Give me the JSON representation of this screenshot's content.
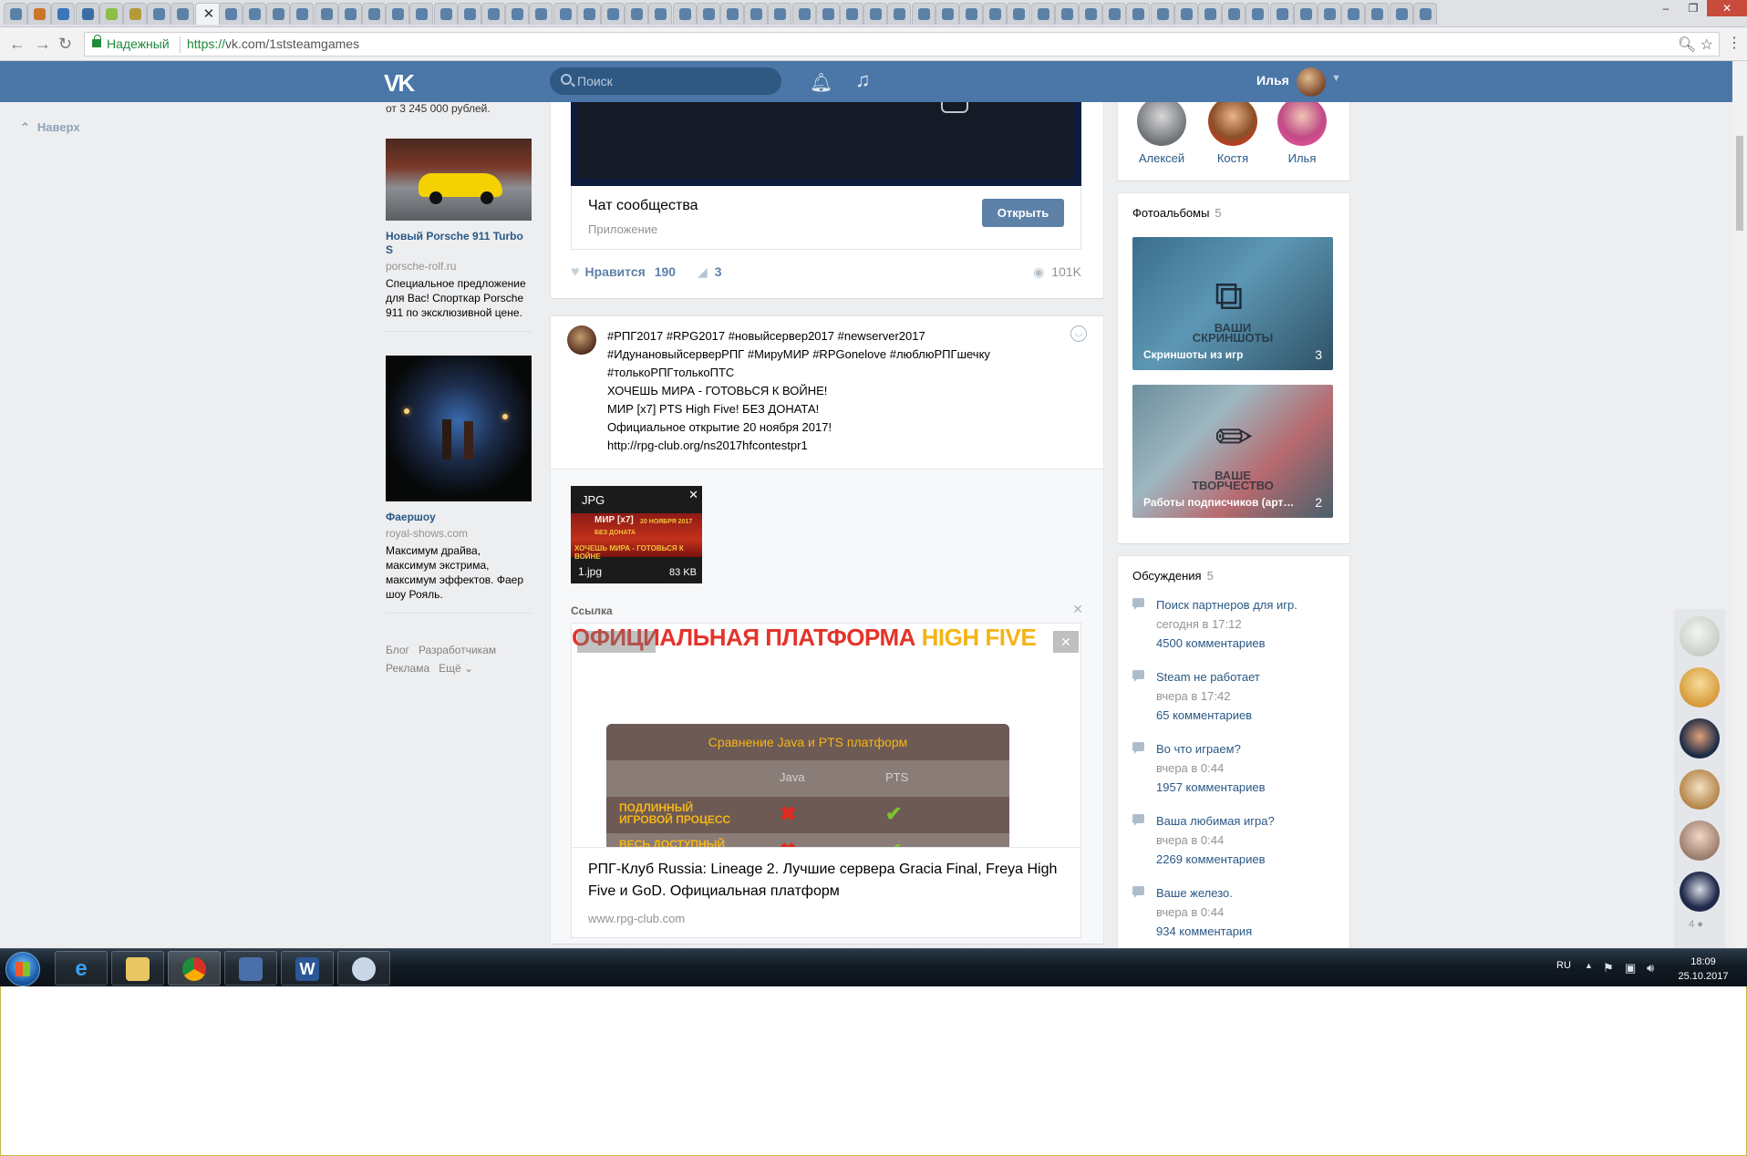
{
  "browser": {
    "secure_label": "Надежный",
    "url_scheme": "https://",
    "url_rest": "vk.com/1ststeamgames"
  },
  "vk_header": {
    "logo": "VK",
    "search_placeholder": "Поиск",
    "user_name": "Илья"
  },
  "left_nav": {
    "to_top": "Наверх"
  },
  "ads": {
    "prev_tail": "от 3 245 000 рублей.",
    "items": [
      {
        "title": "Новый Porsche 911 Turbo S",
        "domain": "porsche-rolf.ru",
        "text": "Специальное предложение для Вас! Спорткар Porsche 911 по эксклюзивной цене."
      },
      {
        "title": "Фаершоу",
        "domain": "royal-shows.com",
        "text": "Максимум драйва, максимум экстрима, максимум эффектов. Фаер шоу Рояль."
      }
    ],
    "footer": [
      "Блог",
      "Разработчикам",
      "Реклама",
      "Ещё ⌄"
    ]
  },
  "post1": {
    "app_title": "Чат сообщества",
    "app_subtitle": "Приложение",
    "open_button": "Открыть",
    "like_label": "Нравится",
    "like_count": "190",
    "share_count": "3",
    "views": "101K"
  },
  "post2": {
    "lines": [
      "#РПГ2017 #RPG2017 #новыйсервер2017 #newserver2017",
      "#ИдунановыйсерверРПГ #МируМИР #RPGonelove #люблюРПГшечку",
      "#толькоРПГтолькоПТС",
      "ХОЧЕШЬ МИРА - ГОТОВЬСЯ К ВОЙНЕ!",
      "МИР [x7] PTS High Five! БЕЗ ДОНАТА!",
      "Официальное открытие 20 ноября 2017!",
      "http://rpg-club.org/ns2017hfcontestpr1"
    ],
    "attachment": {
      "type": "JPG",
      "name": "1.jpg",
      "size": "83 KB",
      "art_line1": "МИР [x7]",
      "art_line2": "20 НОЯБРЯ 2017",
      "art_line3": "БЕЗ ДОНАТА",
      "art_line4": "ХОЧЕШЬ МИРА - ГОТОВЬСЯ К ВОЙНЕ"
    },
    "link": {
      "section_label": "Ссылка",
      "banner_red": "ОФИЦИАЛЬНАЯ ПЛАТФОРМА ",
      "banner_gold": "HIGH FIVE",
      "compare_title": "Сравнение Java и PTS платформ",
      "col_java": "Java",
      "col_pts": "PTS",
      "row1": "ПОДЛИННЫЙ ИГРОВОЙ ПРОЦЕСС",
      "row2": "ВЕСЬ ДОСТУПНЫЙ КОНТЕНТ",
      "title": "РПГ-Клуб Russia: Lineage 2. Лучшие сервера Gracia Final, Freya High Five и GoD. Официальная платформ",
      "domain": "www.rpg-club.com"
    }
  },
  "members": [
    {
      "name": "Алексей",
      "color": "#8c8f94"
    },
    {
      "name": "Костя",
      "color": "#b7793f"
    },
    {
      "name": "Илья",
      "color": "#c85a88"
    }
  ],
  "albums": {
    "title": "Фотоальбомы",
    "count": "5",
    "items": [
      {
        "watermark_1": "ВАШИ",
        "watermark_2": "СКРИНШОТЫ",
        "caption": "Скриншоты из игр",
        "count": "3"
      },
      {
        "watermark_1": "ВАШЕ",
        "watermark_2": "ТВОРЧЕСТВО",
        "caption": "Работы подписчиков (арт…",
        "count": "2"
      }
    ]
  },
  "discussions": {
    "title": "Обсуждения",
    "count": "5",
    "items": [
      {
        "title": "Поиск партнеров для игр.",
        "date": "сегодня в 17:12",
        "comments": "4500 комментариев"
      },
      {
        "title": "Steam не работает",
        "date": "вчера в 17:42",
        "comments": "65 комментариев"
      },
      {
        "title": "Во что играем?",
        "date": "вчера в 0:44",
        "comments": "1957 комментариев"
      },
      {
        "title": "Ваша любимая игра?",
        "date": "вчера в 0:44",
        "comments": "2269 комментариев"
      },
      {
        "title": "Ваше железо.",
        "date": "вчера в 0:44",
        "comments": "934 комментария"
      }
    ]
  },
  "chat_sidebar": {
    "online_count": "4"
  },
  "taskbar": {
    "lang": "RU",
    "time": "18:09",
    "date": "25.10.2017"
  },
  "colors": {
    "vk_blue": "#4a76a8",
    "link_blue": "#2a5885",
    "page_bg": "#edeef0",
    "button_blue": "#5e81a8"
  }
}
